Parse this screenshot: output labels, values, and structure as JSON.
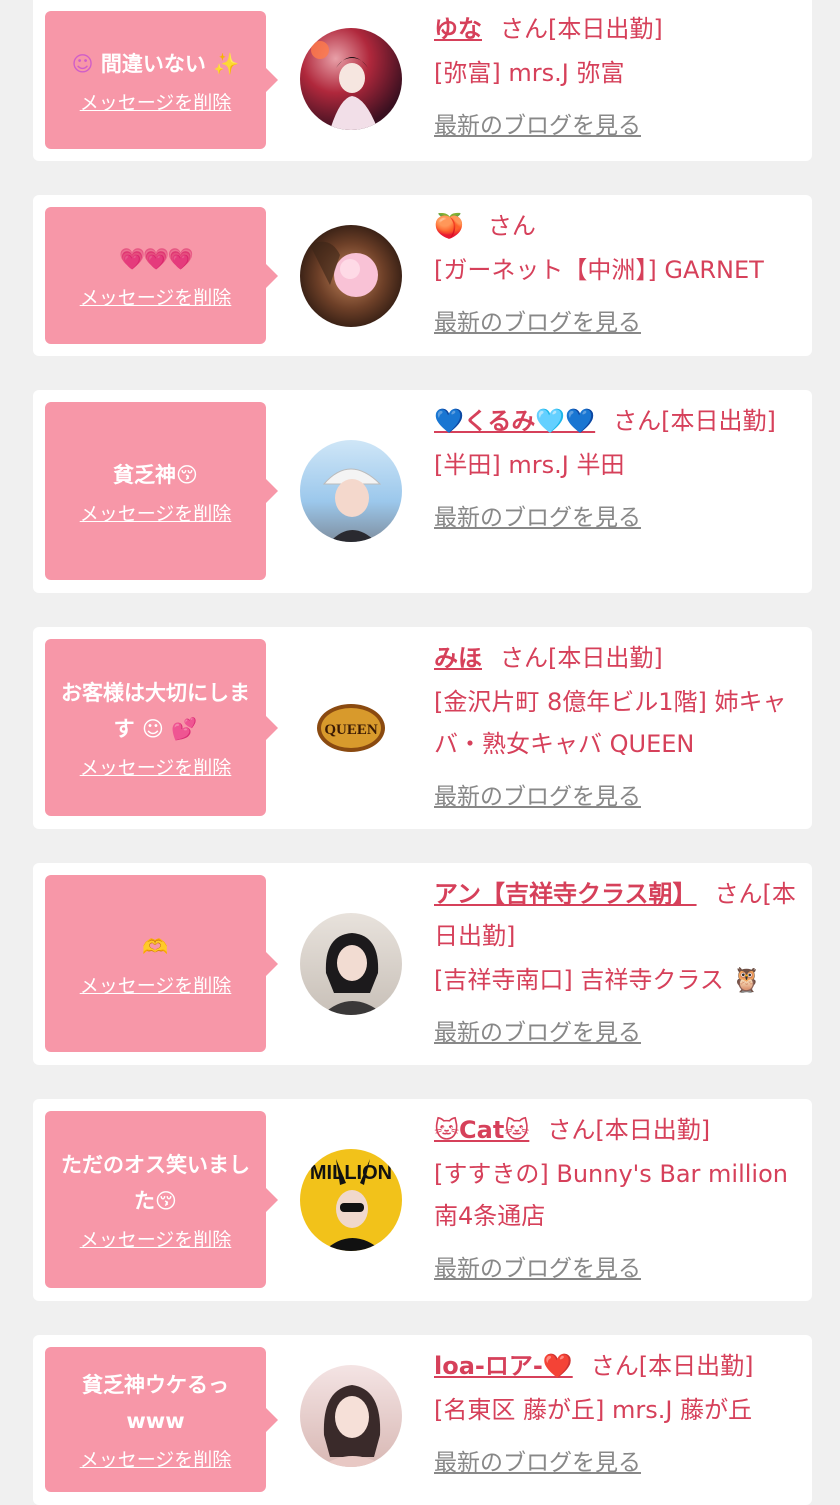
{
  "colors": {
    "background": "#f0f0f0",
    "card": "#ffffff",
    "bubble": "#f797a8",
    "accent": "#d6405a",
    "muted": "#888888"
  },
  "cards": [
    {
      "message": "間違いない",
      "message_icon_left": "☺",
      "message_icon_right": "✨",
      "delete_label": "メッセージを削除",
      "name": "ゆな",
      "san": "さん[本日出勤]",
      "shop": "[弥富] mrs.J 弥富",
      "blog_label": "最新のブログを見る",
      "avatar_icon": "kimono-portrait"
    },
    {
      "message": "💗💗💗",
      "delete_label": "メッセージを削除",
      "name": "🍑",
      "san": "さん",
      "shop": "[ガーネット【中洲】] GARNET",
      "blog_label": "最新のブログを見る",
      "avatar_icon": "peach-blur-portrait"
    },
    {
      "message": "貧乏神😚",
      "delete_label": "メッセージを削除",
      "name": "💙くるみ🩵💙",
      "san": "さん[本日出勤]",
      "shop": "[半田] mrs.J 半田",
      "blog_label": "最新のブログを見る",
      "avatar_icon": "cap-portrait"
    },
    {
      "message": "お客様は大切にします ☺ 💕",
      "delete_label": "メッセージを削除",
      "name": "みほ",
      "san": "さん[本日出勤]",
      "shop": "[金沢片町 8億年ビル1階] 姉キャバ・熟女キャバ QUEEN",
      "blog_label": "最新のブログを見る",
      "avatar_icon": "queen-logo",
      "avatar_text": "QUEEN"
    },
    {
      "message": "🫶",
      "delete_label": "メッセージを削除",
      "name": "アン【吉祥寺クラス朝】",
      "san": "さん[本日出勤]",
      "shop": "[吉祥寺南口] 吉祥寺クラス 🦉",
      "blog_label": "最新のブログを見る",
      "avatar_icon": "dark-hair-portrait"
    },
    {
      "message": "ただのオス笑いました😚",
      "delete_label": "メッセージを削除",
      "name": "🐱Cat🐱",
      "san": "さん[本日出勤]",
      "shop": "[すすきの] Bunny's Bar million 南4条通店",
      "blog_label": "最新のブログを見る",
      "avatar_icon": "bunny-poster",
      "avatar_text": "MILLION"
    },
    {
      "message": "貧乏神ウケるっwww",
      "delete_label": "メッセージを削除",
      "name": "loa-ロア-❤️",
      "san": "さん[本日出勤]",
      "shop": "[名東区 藤が丘] mrs.J 藤が丘",
      "blog_label": "最新のブログを見る",
      "avatar_icon": "blonde-portrait"
    }
  ]
}
